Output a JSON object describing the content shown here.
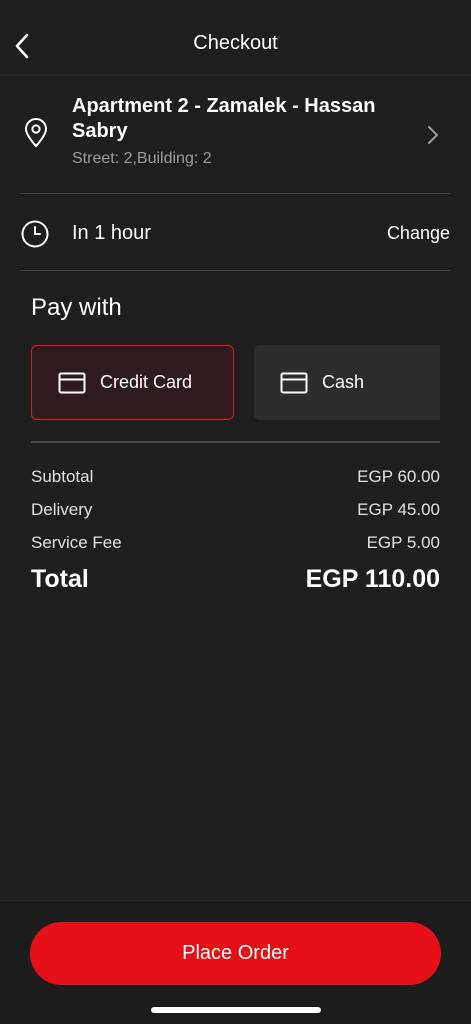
{
  "header": {
    "title": "Checkout"
  },
  "address": {
    "title": "Apartment 2 - Zamalek - Hassan Sabry",
    "subtitle": "Street: 2,Building: 2"
  },
  "delivery_time": {
    "label": "In 1 hour",
    "change_label": "Change"
  },
  "payment": {
    "title": "Pay with",
    "options": [
      {
        "label": "Credit Card",
        "selected": true
      },
      {
        "label": "Cash",
        "selected": false
      }
    ]
  },
  "summary": {
    "subtotal_label": "Subtotal",
    "subtotal_value": "EGP 60.00",
    "delivery_label": "Delivery",
    "delivery_value": "EGP 45.00",
    "service_label": "Service Fee",
    "service_value": "EGP 5.00",
    "total_label": "Total",
    "total_value": "EGP 110.00"
  },
  "actions": {
    "place_order_label": "Place Order"
  },
  "colors": {
    "accent": "#e50f18",
    "background": "#1e1e1e",
    "selected_bg": "#2f1b1d",
    "muted_text": "#9a9a9a"
  },
  "icons": [
    "chevron-left-icon",
    "location-pin-icon",
    "chevron-right-icon",
    "clock-icon",
    "credit-card-icon"
  ]
}
